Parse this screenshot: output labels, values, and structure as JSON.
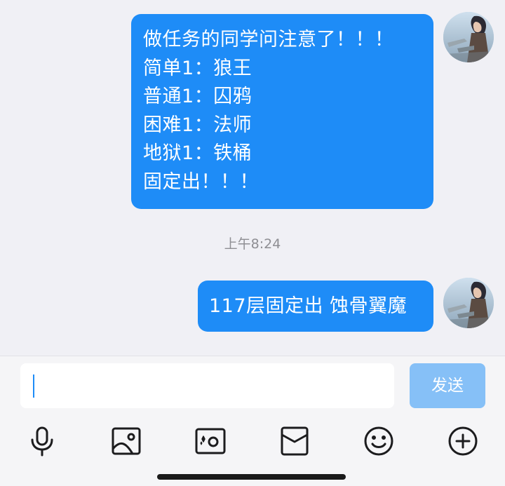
{
  "messages": [
    {
      "lines": [
        "做任务的同学问注意了！！！",
        "简单1：狼王",
        "普通1：囚鸦",
        "困难1：法师",
        "地狱1：铁桶",
        "固定出！！！"
      ]
    },
    {
      "text": "117层固定出  蚀骨翼魔"
    }
  ],
  "timestamp": "上午8:24",
  "composer": {
    "input_value": "",
    "send_label": "发送"
  },
  "toolbar": [
    "microphone-icon",
    "photo-icon",
    "camera-icon",
    "red-packet-icon",
    "emoji-icon",
    "plus-icon"
  ],
  "colors": {
    "bubble": "#1e8cf7",
    "send_disabled": "#86c0f7",
    "background": "#f0f0f5"
  }
}
